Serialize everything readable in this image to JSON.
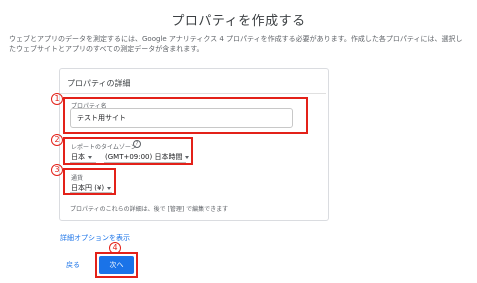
{
  "page": {
    "title": "プロパティを作成する",
    "description": "ウェブとアプリのデータを測定するには、Google アナリティクス 4 プロパティを作成する必要があります。作成した各プロパティには、選択したウェブサイトとアプリのすべての測定データが含まれます。"
  },
  "card": {
    "title": "プロパティの詳細",
    "property_name": {
      "label": "プロパティ名",
      "value": "テスト用サイト"
    },
    "timezone": {
      "label": "レポートのタイムゾーン",
      "help_icon": "?",
      "country": "日本",
      "zone": "(GMT+09:00) 日本時間"
    },
    "currency": {
      "label": "通貨",
      "value": "日本円 (¥)"
    },
    "note": "プロパティのこれらの詳細は、後で [管理] で編集できます"
  },
  "advanced_link": "詳細オプションを表示",
  "buttons": {
    "back": "戻る",
    "next": "次へ"
  },
  "annotations": {
    "n1": "1",
    "n2": "2",
    "n3": "3",
    "n4": "4"
  },
  "colors": {
    "accent": "#1a73e8",
    "annotation": "#e32119"
  }
}
